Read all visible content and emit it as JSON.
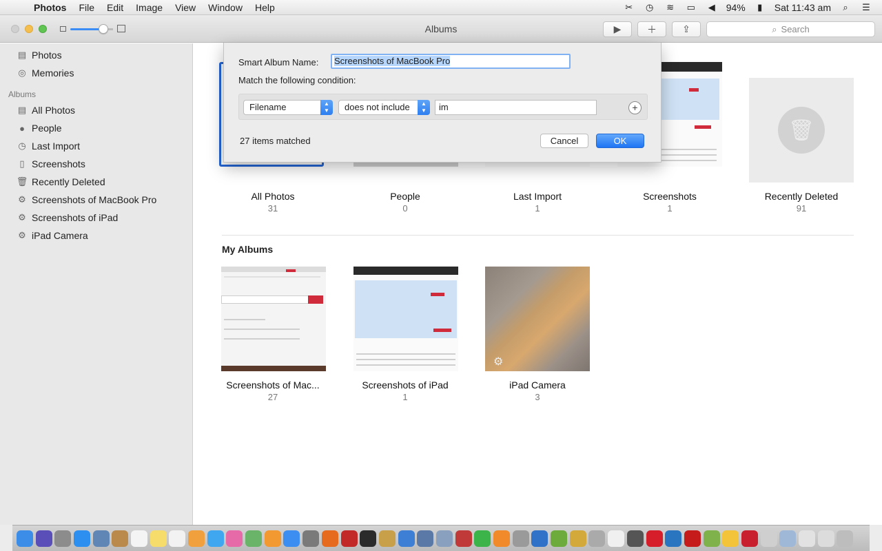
{
  "menubar": {
    "app": "Photos",
    "items": [
      "File",
      "Edit",
      "Image",
      "View",
      "Window",
      "Help"
    ],
    "battery": "94%",
    "clock": "Sat 11:43 am"
  },
  "window": {
    "title": "Albums",
    "search_placeholder": "Search"
  },
  "sidebar": {
    "top_items": [
      {
        "label": "Photos",
        "icon": "photos-icon"
      },
      {
        "label": "Memories",
        "icon": "memories-icon"
      }
    ],
    "albums_header": "Albums",
    "album_items": [
      {
        "label": "All Photos",
        "icon": "all-photos-icon"
      },
      {
        "label": "People",
        "icon": "person-icon"
      },
      {
        "label": "Last Import",
        "icon": "clock-icon"
      },
      {
        "label": "Screenshots",
        "icon": "screenshot-icon"
      },
      {
        "label": "Recently Deleted",
        "icon": "trash-icon"
      },
      {
        "label": "Screenshots of MacBook Pro",
        "icon": "gear-icon"
      },
      {
        "label": "Screenshots of iPad",
        "icon": "gear-icon"
      },
      {
        "label": "iPad Camera",
        "icon": "gear-icon"
      }
    ]
  },
  "main": {
    "top_albums": [
      {
        "label": "All Photos",
        "count": "31"
      },
      {
        "label": "People",
        "count": "0"
      },
      {
        "label": "Last Import",
        "count": "1"
      },
      {
        "label": "Screenshots",
        "count": "1"
      },
      {
        "label": "Recently Deleted",
        "count": "91"
      }
    ],
    "my_albums_title": "My Albums",
    "my_albums": [
      {
        "label": "Screenshots of Mac...",
        "count": "27"
      },
      {
        "label": "Screenshots of iPad",
        "count": "1"
      },
      {
        "label": "iPad Camera",
        "count": "3"
      }
    ]
  },
  "dialog": {
    "name_label": "Smart Album Name:",
    "name_value": "Screenshots of MacBook Pro",
    "match_label": "Match the following condition:",
    "rule_field": "Filename",
    "rule_operator": "does not include",
    "rule_value": "im",
    "matched": "27 items matched",
    "cancel": "Cancel",
    "ok": "OK"
  },
  "dock": {
    "icons": [
      {
        "name": "finder",
        "color": "#3b8de8"
      },
      {
        "name": "siri",
        "color": "#5a4fb8"
      },
      {
        "name": "launchpad",
        "color": "#8c8c8c"
      },
      {
        "name": "safari",
        "color": "#2d8ff0"
      },
      {
        "name": "preview",
        "color": "#5f86b5"
      },
      {
        "name": "contacts",
        "color": "#b98a4b"
      },
      {
        "name": "calendar",
        "color": "#f4f4f4"
      },
      {
        "name": "notes",
        "color": "#f6dc6b"
      },
      {
        "name": "reminders",
        "color": "#f2f2f2"
      },
      {
        "name": "photos",
        "color": "#f0a03c"
      },
      {
        "name": "messages",
        "color": "#3fa7f0"
      },
      {
        "name": "itunes",
        "color": "#e56aa7"
      },
      {
        "name": "maps",
        "color": "#6ab46a"
      },
      {
        "name": "ibooks",
        "color": "#f29a31"
      },
      {
        "name": "app-store",
        "color": "#3c8ff1"
      },
      {
        "name": "system-preferences",
        "color": "#7a7a7a"
      },
      {
        "name": "firefox",
        "color": "#e66b1e"
      },
      {
        "name": "filezilla",
        "color": "#c22a2a"
      },
      {
        "name": "terminal",
        "color": "#2b2b2b"
      },
      {
        "name": "script-editor",
        "color": "#c9a04a"
      },
      {
        "name": "xcode",
        "color": "#3d7fd4"
      },
      {
        "name": "app-1",
        "color": "#5b79a6"
      },
      {
        "name": "app-2",
        "color": "#8aa0bf"
      },
      {
        "name": "app-3",
        "color": "#c03a3a"
      },
      {
        "name": "facetime",
        "color": "#3cb44a"
      },
      {
        "name": "app-4",
        "color": "#f08a2a"
      },
      {
        "name": "app-5",
        "color": "#9a9a9a"
      },
      {
        "name": "app-6",
        "color": "#2f72c8"
      },
      {
        "name": "android",
        "color": "#6cab3c"
      },
      {
        "name": "app-7",
        "color": "#d3a93c"
      },
      {
        "name": "app-8",
        "color": "#aaaaaa"
      },
      {
        "name": "textedit",
        "color": "#f0f0f0"
      },
      {
        "name": "app-9",
        "color": "#555555"
      },
      {
        "name": "opera",
        "color": "#d61d2a"
      },
      {
        "name": "vscode",
        "color": "#2a75c0"
      },
      {
        "name": "acrobat",
        "color": "#c61b1b"
      },
      {
        "name": "app-10",
        "color": "#7fb24a"
      },
      {
        "name": "chrome",
        "color": "#f3c33a"
      },
      {
        "name": "app-11",
        "color": "#c8202e"
      },
      {
        "name": "app-12",
        "color": "#cfcfcf"
      },
      {
        "name": "app-13",
        "color": "#9fb8d8"
      },
      {
        "name": "app-14",
        "color": "#e2e2e2"
      },
      {
        "name": "app-15",
        "color": "#dcdcdc"
      },
      {
        "name": "trash",
        "color": "#bdbdbd"
      }
    ]
  }
}
